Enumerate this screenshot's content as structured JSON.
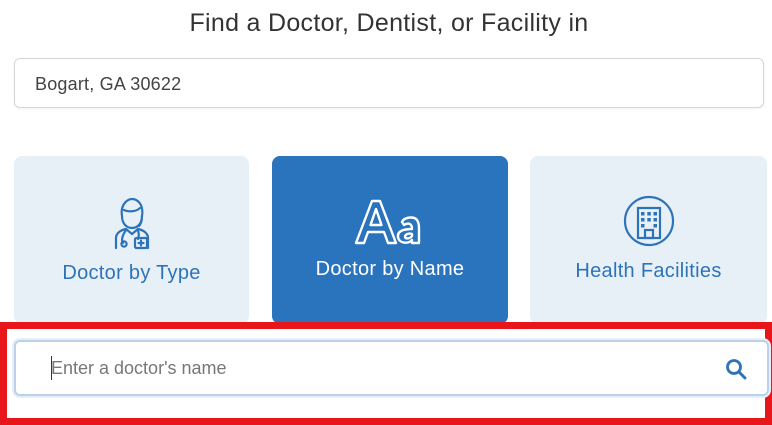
{
  "heading": "Find a Doctor, Dentist, or Facility in",
  "location": {
    "value": "Bogart, GA 30622"
  },
  "search_modes": [
    {
      "label": "Doctor by Type",
      "icon": "doctor-icon",
      "selected": false
    },
    {
      "label": "Doctor by Name",
      "icon": "font-aa-icon",
      "selected": true
    },
    {
      "label": "Health Facilities",
      "icon": "hospital-building-icon",
      "selected": false
    }
  ],
  "name_search": {
    "placeholder": "Enter a doctor's name",
    "value": "",
    "button_icon": "search-icon"
  },
  "colors": {
    "accent": "#2a73bd",
    "card_light": "#e8f0f7",
    "highlight_frame": "#e8151b"
  }
}
